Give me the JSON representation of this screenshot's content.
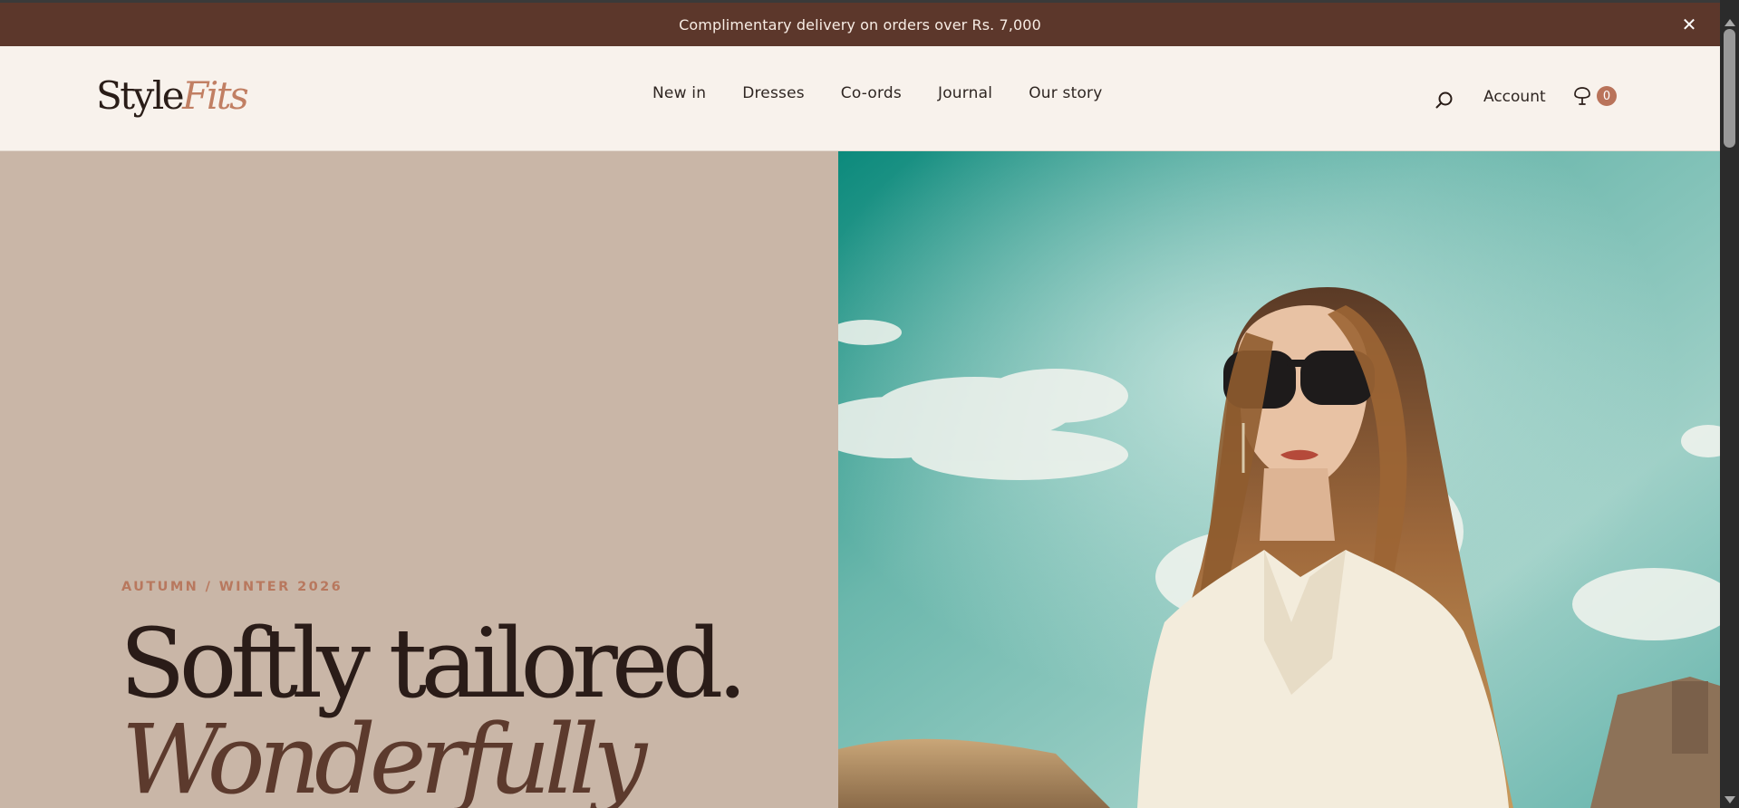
{
  "announcement": {
    "text": "Complimentary delivery on orders over Rs. 7,000",
    "close_label": "✕"
  },
  "header": {
    "logo": {
      "part1": "Style",
      "part2": "Fits"
    },
    "nav": [
      "New in",
      "Dresses",
      "Co-ords",
      "Journal",
      "Our story"
    ],
    "account_label": "Account",
    "cart_count": "0"
  },
  "hero": {
    "eyebrow": "AUTUMN / WINTER 2026",
    "title_line1": "Softly tailored.",
    "title_line2": "Wonderfully",
    "image_icon": "hero-photo"
  },
  "colors": {
    "announcement_bg": "#5c372b",
    "header_bg": "#f8f2ec",
    "hero_left_bg": "#c9b6a7",
    "accent": "#b9735a",
    "dark_text": "#2a1c18"
  },
  "icons": {
    "close": "close-icon",
    "search": "search-icon",
    "cart": "shopping-bag-icon",
    "scroll_up": "scroll-up-arrow-icon",
    "scroll_down": "scroll-down-arrow-icon"
  }
}
